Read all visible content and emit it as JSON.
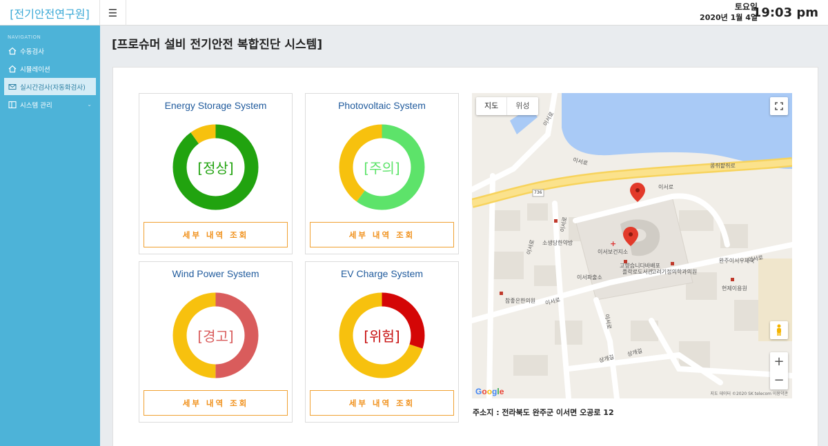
{
  "header": {
    "brand": "[전기안전연구원]",
    "menu_icon": "hamburger-icon",
    "day_of_week": "토요일",
    "date": "2020년 1월 4일",
    "time": "19:03 pm"
  },
  "sidebar": {
    "section_title": "NAVIGATION",
    "items": [
      {
        "label": "수동검사",
        "icon": "home-icon"
      },
      {
        "label": "시뮬레이션",
        "icon": "home-icon"
      },
      {
        "label": "실시간검사(자동화검사)",
        "icon": "mail-icon",
        "active": true
      },
      {
        "label": "시스템 관리",
        "icon": "layout-icon",
        "chevron": "⌄"
      }
    ]
  },
  "page": {
    "title": "[프로슈머 설비 전기안전 복합진단 시스템]"
  },
  "systems": [
    {
      "name": "Energy Storage System",
      "status": "[정상]",
      "status_color": "#21a30f",
      "button": "세부 내역 조회",
      "ring": [
        {
          "fraction": 0.9,
          "color": "#21a30f"
        },
        {
          "fraction": 0.1,
          "color": "#f7c10e"
        }
      ]
    },
    {
      "name": "Photovoltaic System",
      "status": "[주의]",
      "status_color": "#5de36a",
      "button": "세부 내역 조회",
      "ring": [
        {
          "fraction": 0.6,
          "color": "#5de36a"
        },
        {
          "fraction": 0.4,
          "color": "#f7c10e"
        }
      ]
    },
    {
      "name": "Wind Power System",
      "status": "[경고]",
      "status_color": "#d95c5c",
      "button": "세부 내역 조회",
      "ring": [
        {
          "fraction": 0.5,
          "color": "#d95c5c"
        },
        {
          "fraction": 0.5,
          "color": "#f7c10e"
        }
      ]
    },
    {
      "name": "EV Charge System",
      "status": "[위험]",
      "status_color": "#c81010",
      "button": "세부 내역 조회",
      "ring": [
        {
          "fraction": 0.3,
          "color": "#d40606"
        },
        {
          "fraction": 0.7,
          "color": "#f7c10e"
        }
      ]
    }
  ],
  "map": {
    "tab_map": "지도",
    "tab_satellite": "위성",
    "fullscreen_icon": "fullscreen-icon",
    "pegman_icon": "pegman-icon",
    "zoom_in": "+",
    "zoom_out": "−",
    "logo": "Google",
    "attribution": "지도 데이터 ©2020 SK telecom   이용약관",
    "labels": {
      "road1": "이서로",
      "road2": "이서로",
      "road3": "콩쥐팥쥐로",
      "road4": "이서로",
      "road5": "이서로",
      "road6": "이서로",
      "road7": "이서로",
      "road8": "이서로",
      "road9": "이서로",
      "road10": "상개길",
      "road11": "상개길",
      "route_badge": "736",
      "poi1": "소생당한약방",
      "poi2": "이서보건지소",
      "poi3": "고향습니다바배포",
      "poi4": "플락로도서관",
      "poi5": "고려기정의학과의원",
      "poi6": "완주이서우체국",
      "poi7": "이서파출소",
      "poi8": "현제이용원",
      "poi9": "참좋은한의원"
    }
  },
  "address": "주소지 : 전라북도 완주군 이서면 오공로 12"
}
